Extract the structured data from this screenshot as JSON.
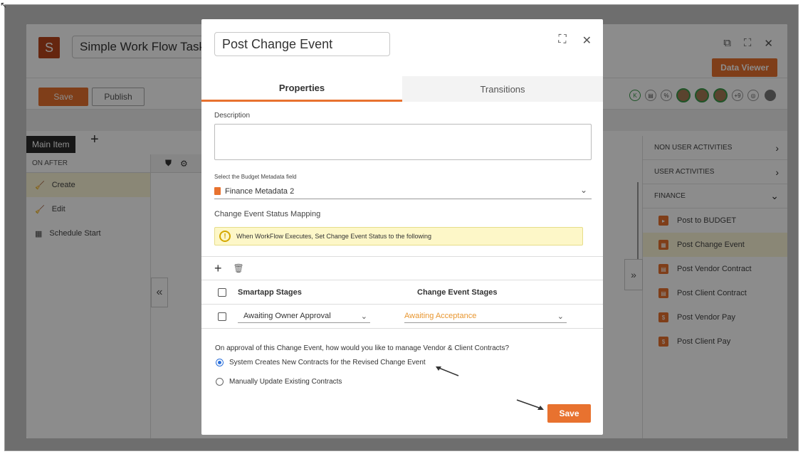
{
  "app": {
    "logo_letter": "S",
    "title": "Simple Work Flow Task",
    "data_viewer_label": "Data Viewer",
    "save_label": "Save",
    "publish_label": "Publish",
    "tab_main_item": "Main Item",
    "tab_add": "+"
  },
  "left_panel": {
    "header": "ON AFTER",
    "items": [
      {
        "label": "Create",
        "icon": "broom-icon"
      },
      {
        "label": "Edit",
        "icon": "broom-icon"
      },
      {
        "label": "Schedule Start",
        "icon": "calendar-icon"
      }
    ]
  },
  "right_panel": {
    "sections": [
      "NON USER ACTIVITIES",
      "USER ACTIVITIES",
      "FINANCE"
    ],
    "items": [
      "Post to BUDGET",
      "Post Change Event",
      "Post Vendor Contract",
      "Post Client Contract",
      "Post Vendor Pay",
      "Post Client Pay"
    ]
  },
  "modal": {
    "title": "Post Change Event",
    "tabs": [
      "Properties",
      "Transitions"
    ],
    "description_label": "Description",
    "budget_field_label": "Select the Budget Metadata field",
    "budget_field_value": "Finance Metadata 2",
    "mapping_label": "Change Event Status Mapping",
    "notice": "When WorkFlow Executes, Set Change Event Status to the following",
    "table": {
      "headers": [
        "Smartapp Stages",
        "Change Event Stages"
      ],
      "rows": [
        {
          "stage": "Awaiting Owner Approval",
          "event_stage": "Awaiting Acceptance"
        }
      ]
    },
    "question": "On approval of this Change Event, how would you like to manage Vendor & Client Contracts?",
    "options": [
      {
        "label": "System Creates New Contracts for the Revised Change Event",
        "selected": true
      },
      {
        "label": "Manually Update Existing Contracts",
        "selected": false
      }
    ],
    "save_label": "Save"
  },
  "colors": {
    "accent": "#e8722f",
    "brand_logo": "#b8451d",
    "highlight_row": "#fbf6d8",
    "notice_bg": "#fdf7c8",
    "radio_selected": "#2a6fdb"
  }
}
